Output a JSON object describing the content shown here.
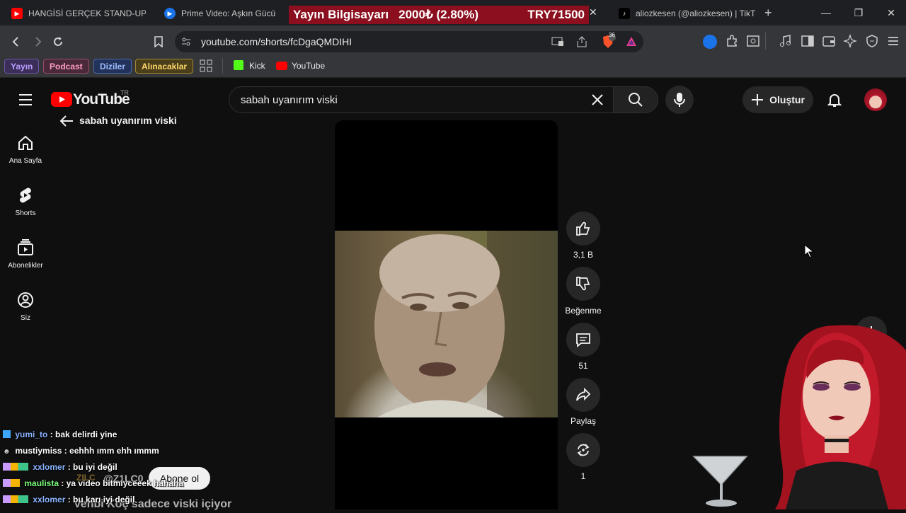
{
  "browser": {
    "tabs": [
      {
        "title": "HANGİSİ GERÇEK STAND-UP K",
        "favicon": "youtube-favicon-icon"
      },
      {
        "title": "Prime Video: Aşkın Gücü",
        "favicon": "prime-video-favicon-icon"
      },
      {
        "title": "aliozkesen (@aliozkesen) | TikT",
        "favicon": "tiktok-favicon-icon"
      }
    ],
    "url": "youtube.com/shorts/fcDgaQMDIHI",
    "bookmark_chips": [
      "Yayın",
      "Podcast",
      "Diziler",
      "Alınacaklar"
    ],
    "bookmarks": [
      "Kick",
      "YouTube"
    ],
    "brave_badge": "36"
  },
  "stream_overlay": {
    "title": "Yayın Bilgisayarı",
    "progress": "2000₺ (2.80%)",
    "goal": "TRY71500"
  },
  "youtube": {
    "logo": "YouTube",
    "region": "TR",
    "search_value": "sabah uyanırım viski",
    "back_label": "sabah uyanırım viski",
    "create_label": "Oluştur",
    "sidebar": [
      {
        "label": "Ana Sayfa",
        "icon": "home-icon"
      },
      {
        "label": "Shorts",
        "icon": "shorts-icon"
      },
      {
        "label": "Abonelikler",
        "icon": "subscriptions-icon"
      },
      {
        "label": "Siz",
        "icon": "you-icon"
      }
    ],
    "actions": {
      "likes": "3,1 B",
      "dislike_label": "Beğenme",
      "comments": "51",
      "share_label": "Paylaş",
      "remix": "1"
    },
    "channel": "@Z1LC0",
    "channel_logo": "ZILC",
    "subscribe_label": "Abone ol",
    "video_title": "Vehbi Koç sadece viski içiyor"
  },
  "chat": [
    {
      "user": "yumi_to",
      "message": ": bak delirdi yine"
    },
    {
      "user": "mustiymiss",
      "message": ": eehhh ımm ehh ımmm"
    },
    {
      "user": "xxlomer",
      "message": ": bu iyi değil"
    },
    {
      "user": "maulista",
      "message": ": ya video bitmiyceeek hahaha"
    },
    {
      "user": "xxlomer",
      "message": ": bu karı iyi değil"
    }
  ],
  "colors": {
    "accent": "#ff0000",
    "overlay": "#8b0f1e",
    "chat_user": "#8ab4ff"
  }
}
